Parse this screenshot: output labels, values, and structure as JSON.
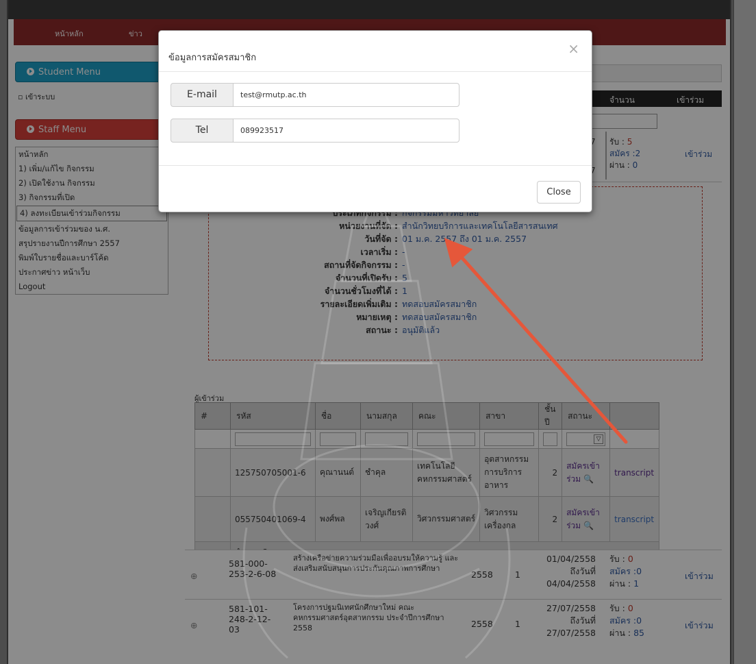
{
  "nav": {
    "items": [
      "หน้าหลัก",
      "ข่าว"
    ]
  },
  "sidebar": {
    "student_menu": "Student Menu",
    "login": "เข้าระบบ",
    "staff_menu": "Staff Menu",
    "staff_items": [
      "หน้าหลัก",
      "1) เพิ่ม/แก้ไข กิจกรรม",
      "2) เปิดใช้งาน กิจกรรม",
      "3) กิจกรรมที่เปิด",
      "4) ลงทะเบียนเข้าร่วมกิจกรรม",
      "ข้อมูลการเข้าร่วมของ น.ศ.",
      "สรุปรายงานปีการศึกษา 2557",
      "พิมพ์ใบรายชื่อและบาร์โค้ด",
      "ประกาศข่าว หน้าเว็บ",
      "Logout"
    ]
  },
  "grid": {
    "col_amount": "จำนวน",
    "col_join": "เข้าร่วม",
    "row1": {
      "d1": "7",
      "d2": "7",
      "recv": "รับ :",
      "recv_n": "5",
      "apply": "สมัคร :2",
      "pass": "ผ่าน :",
      "pass_n": "0",
      "join": "เข้าร่วม"
    }
  },
  "detail": {
    "type_label": "ประเภทกิจกรรม :",
    "type_value": "กิจกรรมมหาวิทยาลัย",
    "org_label": "หน่วยงานที่จัด :",
    "org_value": "สำนักวิทยบริการและเทคโนโลยีสารสนเทศ",
    "date_label": "วันที่จัด :",
    "date_value": "01 ม.ค. 2557 ถึง 01 ม.ค. 2557",
    "time_label": "เวลาเริ่ม :",
    "time_value": "-",
    "place_label": "สถานที่จัดกิจกรรม :",
    "place_value": "-",
    "cap_label": "จำนวนที่เปิดรับ :",
    "cap_value": "5",
    "hours_label": "จำนวนชั่วโมงที่ได้ :",
    "hours_value": "1",
    "more_label": "รายละเอียดเพิ่มเติม :",
    "more_value": "ทดสอบสมัครสมาชิก",
    "note_label": "หมายเหตุ :",
    "note_value": "ทดสอบสมัครสมาชิก",
    "status_label": "สถานะ :",
    "status_value": "อนุมัติแล้ว"
  },
  "participants": {
    "title": "ผู้เข้าร่วม",
    "headers": [
      "#",
      "รหัส",
      "ชื่อ",
      "นามสกุล",
      "คณะ",
      "สาขา",
      "ชั้นปี",
      "สถานะ"
    ],
    "rows": [
      {
        "id": "125750705001-6",
        "first": "คุณานนต์",
        "last": "ชำคุล",
        "faculty": "เทคโนโลยีคหกรรมศาสตร์",
        "major": "อุตสาหกรรมการบริการอาหาร",
        "year": "2",
        "status": "สมัครเข้าร่วม",
        "link": "transcript"
      },
      {
        "id": "055750401069-4",
        "first": "พงศ์พล",
        "last": "เจริญเกียรติวงศ์",
        "faculty": "วิศวกรรมศาสตร์",
        "major": "วิศวกรรมเครื่องกล",
        "year": "2",
        "status": "สมัครเข้าร่วม",
        "link": "transcript"
      }
    ],
    "total": "จำนวน 2 คน"
  },
  "activities": [
    {
      "code": "581-000-253-2-6-08",
      "name": "สร้างเครือข่ายความร่วมมือเพื่ออบรมให้ความรู้ และส่งเสริมสนับสนุนการประกันคุณภาพการศึกษา",
      "year": "2558",
      "n": "1",
      "date_from": "01/04/2558",
      "to": "ถึงวันที่",
      "date_to": "04/04/2558",
      "recv": "รับ :",
      "recv_n": "0",
      "apply": "สมัคร :0",
      "pass": "ผ่าน :",
      "pass_n": "1",
      "join": "เข้าร่วม"
    },
    {
      "code": "581-101-248-2-12-03",
      "name": "โครงการปฐมนิเทศนักศึกษาใหม่ คณะคหกรรมศาสตร์อุตสาหกรรม ประจำปีการศึกษา 2558",
      "year": "2558",
      "n": "1",
      "date_from": "27/07/2558",
      "to": "ถึงวันที่",
      "date_to": "27/07/2558",
      "recv": "รับ :",
      "recv_n": "0",
      "apply": "สมัคร :0",
      "pass": "ผ่าน :",
      "pass_n": "85",
      "join": "เข้าร่วม"
    }
  ],
  "modal": {
    "title": "ข้อมูลการสมัครสมาชิก",
    "close_symbol": "×",
    "email_label": "E-mail",
    "email_value": "test@rmutp.ac.th",
    "tel_label": "Tel",
    "tel_value": "089923517",
    "close_button": "Close"
  },
  "colors": {
    "navbar": "#8f2a2a",
    "student_menu": "#1ea0c9",
    "staff_menu": "#d9413b",
    "arrow": "#e5573a"
  }
}
